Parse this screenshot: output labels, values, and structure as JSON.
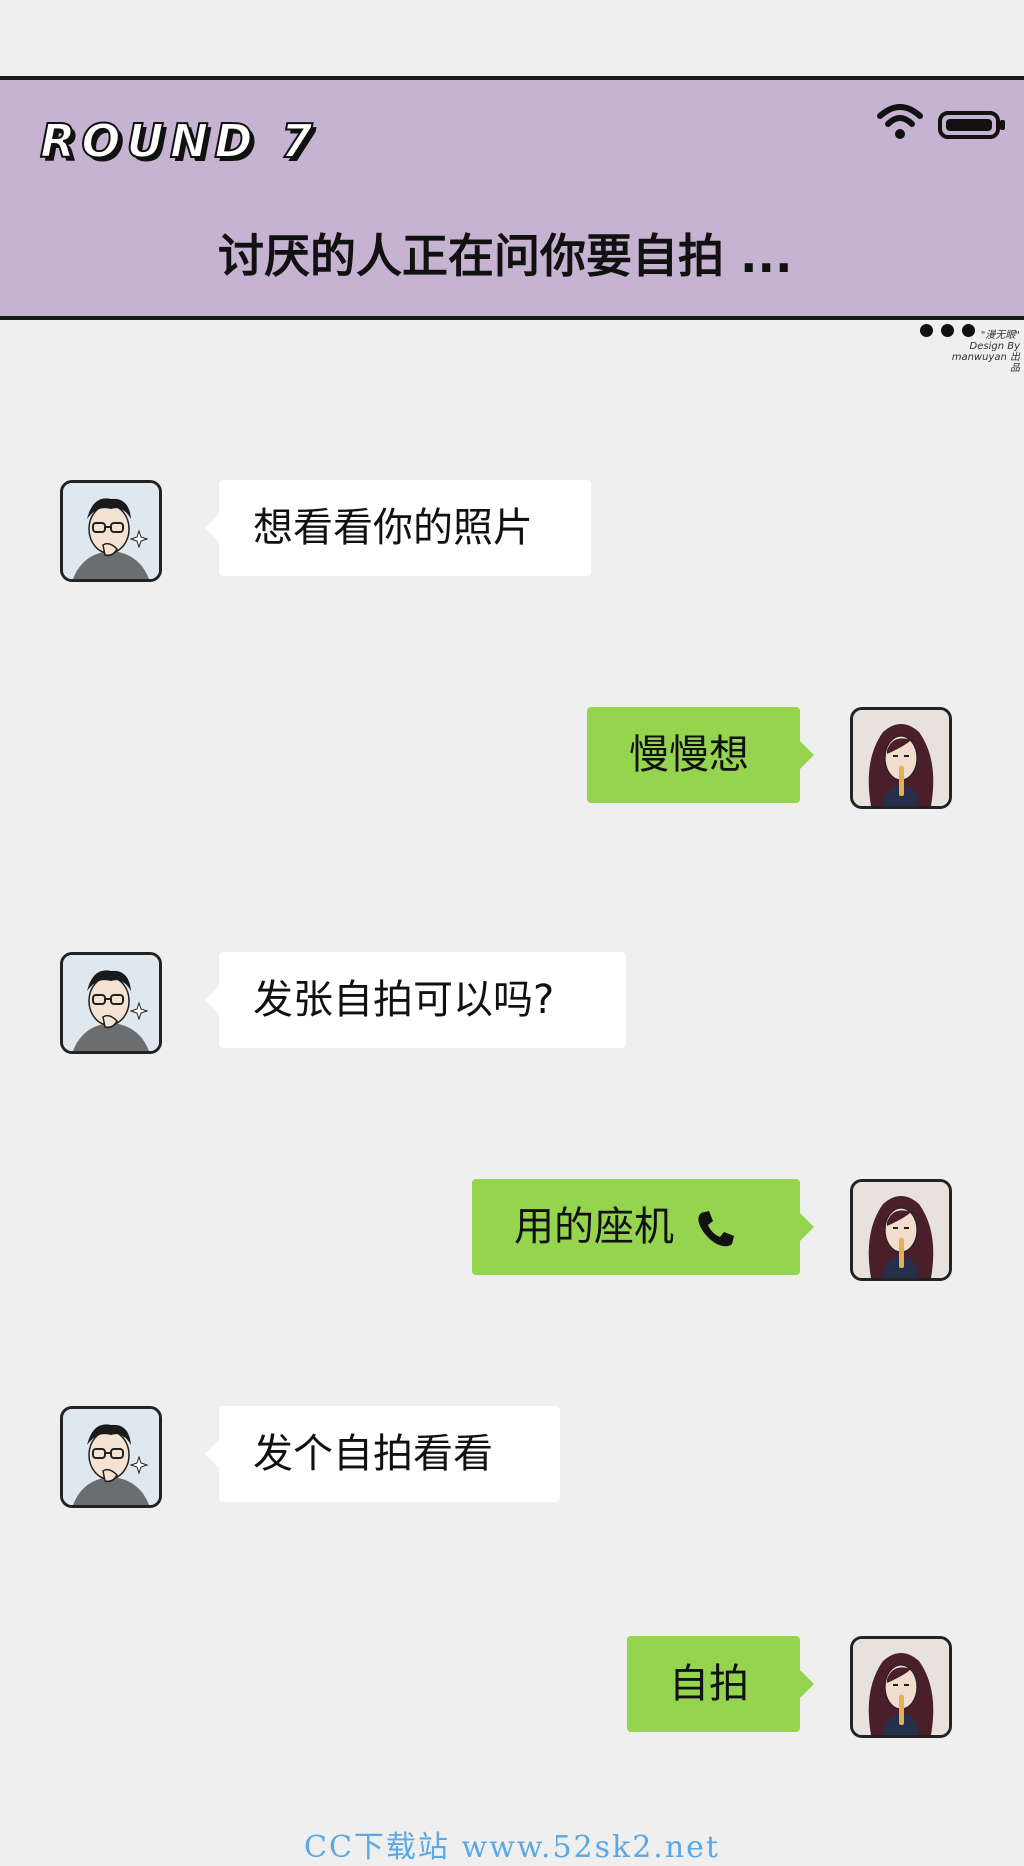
{
  "header": {
    "round_label": "ROUND 7",
    "chat_title": "讨厌的人正在问你要自拍 ...",
    "more_label": "..."
  },
  "logo_text": "\"漫无眼\" Design By manwuyan 出品",
  "messages": [
    {
      "side": "left",
      "text": "想看看你的照片"
    },
    {
      "side": "right",
      "text": "慢慢想"
    },
    {
      "side": "left",
      "text": "发张自拍可以吗?"
    },
    {
      "side": "right",
      "text": "用的座机",
      "icon": "phone-icon"
    },
    {
      "side": "left",
      "text": "发个自拍看看"
    },
    {
      "side": "right",
      "text": "自拍"
    }
  ],
  "footer": {
    "watermark": "CC下载站 www.52sk2.net"
  },
  "colors": {
    "header_bg": "#c6b3d1",
    "page_bg": "#efefef",
    "incoming_bubble": "#ffffff",
    "outgoing_bubble": "#95d44f",
    "watermark_text": "#5aa8e6"
  }
}
